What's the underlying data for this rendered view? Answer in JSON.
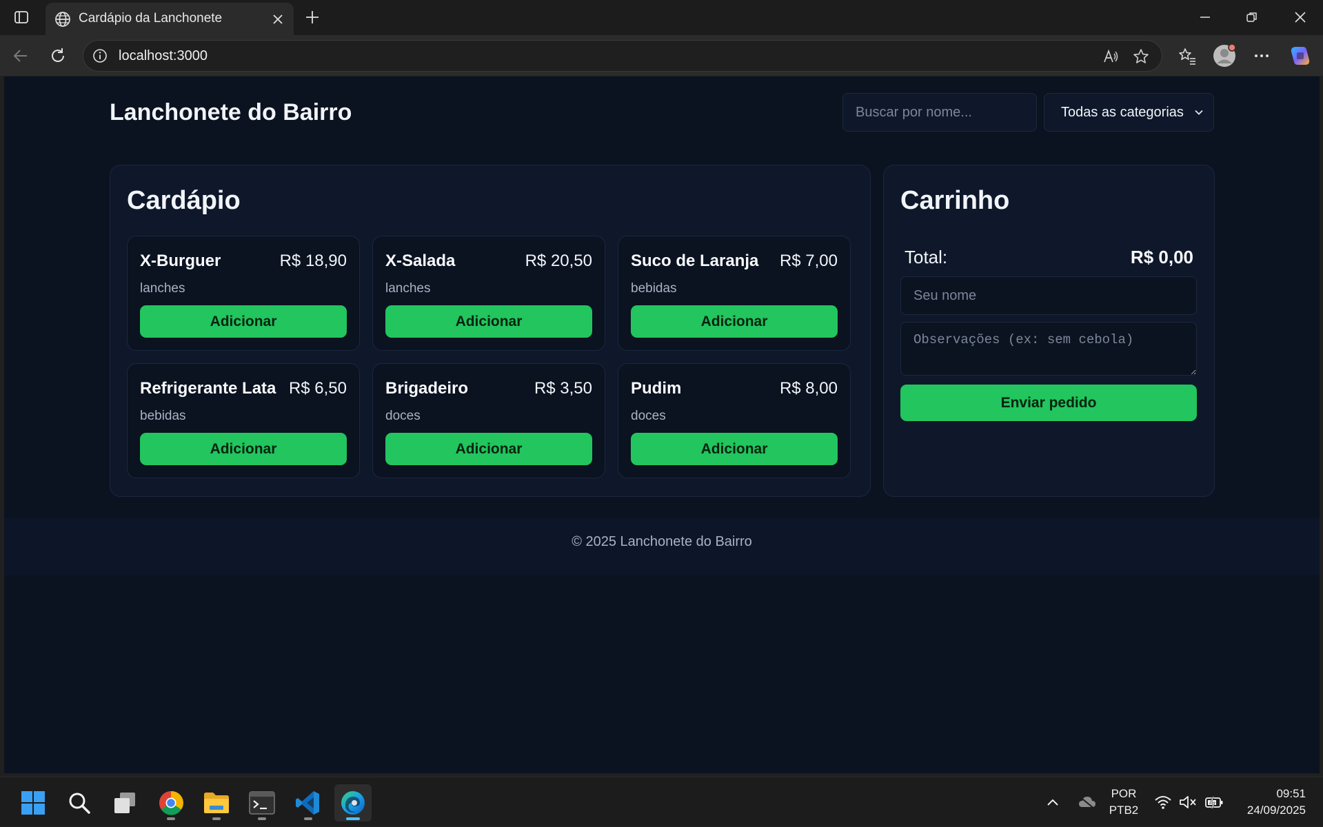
{
  "browser": {
    "tab_title": "Cardápio da Lanchonete",
    "url": "localhost:3000"
  },
  "header": {
    "title": "Lanchonete do Bairro",
    "search_placeholder": "Buscar por nome...",
    "category_selected": "Todas as categorias"
  },
  "menu": {
    "title": "Cardápio",
    "add_label": "Adicionar",
    "items": [
      {
        "name": "X-Burguer",
        "price": "R$ 18,90",
        "category": "lanches"
      },
      {
        "name": "X-Salada",
        "price": "R$ 20,50",
        "category": "lanches"
      },
      {
        "name": "Suco de Laranja",
        "price": "R$ 7,00",
        "category": "bebidas"
      },
      {
        "name": "Refrigerante Lata",
        "price": "R$ 6,50",
        "category": "bebidas"
      },
      {
        "name": "Brigadeiro",
        "price": "R$ 3,50",
        "category": "doces"
      },
      {
        "name": "Pudim",
        "price": "R$ 8,00",
        "category": "doces"
      }
    ]
  },
  "cart": {
    "title": "Carrinho",
    "total_label": "Total:",
    "total_value": "R$ 0,00",
    "name_placeholder": "Seu nome",
    "notes_placeholder": "Observações (ex: sem cebola)",
    "submit_label": "Enviar pedido"
  },
  "footer": {
    "text": "© 2025 Lanchonete do Bairro"
  },
  "taskbar": {
    "lang_line1": "POR",
    "lang_line2": "PTB2",
    "time": "09:51",
    "date": "24/09/2025"
  },
  "colors": {
    "page_bg": "#0b1220",
    "panel_bg": "#0f172a",
    "accent_green": "#22c55e",
    "muted_text": "#a8b3c4"
  },
  "icons": [
    "tab-actions-icon",
    "globe-icon",
    "close-icon",
    "plus-icon",
    "minimize-icon",
    "restore-icon",
    "back-icon",
    "refresh-icon",
    "info-icon",
    "read-aloud-icon",
    "favorite-star-icon",
    "favorites-icon",
    "profile-icon",
    "more-icon",
    "copilot-icon",
    "chevron-down-icon",
    "windows-start-icon",
    "search-icon",
    "task-view-icon",
    "chrome-icon",
    "file-explorer-icon",
    "terminal-icon",
    "vscode-icon",
    "edge-icon",
    "chevron-up-icon",
    "onedrive-icon",
    "wifi-icon",
    "volume-mute-icon",
    "battery-icon"
  ]
}
